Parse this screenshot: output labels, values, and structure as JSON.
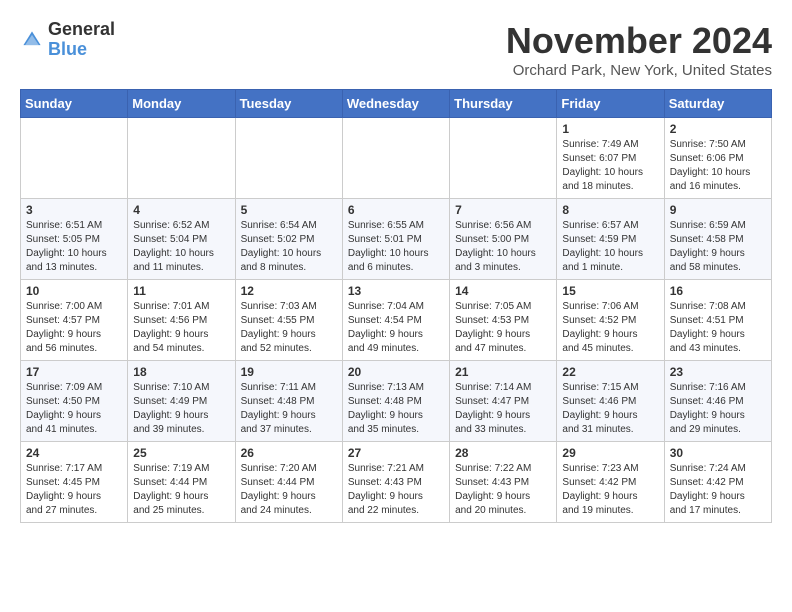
{
  "header": {
    "logo_general": "General",
    "logo_blue": "Blue",
    "month_title": "November 2024",
    "location": "Orchard Park, New York, United States"
  },
  "days_of_week": [
    "Sunday",
    "Monday",
    "Tuesday",
    "Wednesday",
    "Thursday",
    "Friday",
    "Saturday"
  ],
  "weeks": [
    [
      {
        "day": "",
        "info": ""
      },
      {
        "day": "",
        "info": ""
      },
      {
        "day": "",
        "info": ""
      },
      {
        "day": "",
        "info": ""
      },
      {
        "day": "",
        "info": ""
      },
      {
        "day": "1",
        "info": "Sunrise: 7:49 AM\nSunset: 6:07 PM\nDaylight: 10 hours\nand 18 minutes."
      },
      {
        "day": "2",
        "info": "Sunrise: 7:50 AM\nSunset: 6:06 PM\nDaylight: 10 hours\nand 16 minutes."
      }
    ],
    [
      {
        "day": "3",
        "info": "Sunrise: 6:51 AM\nSunset: 5:05 PM\nDaylight: 10 hours\nand 13 minutes."
      },
      {
        "day": "4",
        "info": "Sunrise: 6:52 AM\nSunset: 5:04 PM\nDaylight: 10 hours\nand 11 minutes."
      },
      {
        "day": "5",
        "info": "Sunrise: 6:54 AM\nSunset: 5:02 PM\nDaylight: 10 hours\nand 8 minutes."
      },
      {
        "day": "6",
        "info": "Sunrise: 6:55 AM\nSunset: 5:01 PM\nDaylight: 10 hours\nand 6 minutes."
      },
      {
        "day": "7",
        "info": "Sunrise: 6:56 AM\nSunset: 5:00 PM\nDaylight: 10 hours\nand 3 minutes."
      },
      {
        "day": "8",
        "info": "Sunrise: 6:57 AM\nSunset: 4:59 PM\nDaylight: 10 hours\nand 1 minute."
      },
      {
        "day": "9",
        "info": "Sunrise: 6:59 AM\nSunset: 4:58 PM\nDaylight: 9 hours\nand 58 minutes."
      }
    ],
    [
      {
        "day": "10",
        "info": "Sunrise: 7:00 AM\nSunset: 4:57 PM\nDaylight: 9 hours\nand 56 minutes."
      },
      {
        "day": "11",
        "info": "Sunrise: 7:01 AM\nSunset: 4:56 PM\nDaylight: 9 hours\nand 54 minutes."
      },
      {
        "day": "12",
        "info": "Sunrise: 7:03 AM\nSunset: 4:55 PM\nDaylight: 9 hours\nand 52 minutes."
      },
      {
        "day": "13",
        "info": "Sunrise: 7:04 AM\nSunset: 4:54 PM\nDaylight: 9 hours\nand 49 minutes."
      },
      {
        "day": "14",
        "info": "Sunrise: 7:05 AM\nSunset: 4:53 PM\nDaylight: 9 hours\nand 47 minutes."
      },
      {
        "day": "15",
        "info": "Sunrise: 7:06 AM\nSunset: 4:52 PM\nDaylight: 9 hours\nand 45 minutes."
      },
      {
        "day": "16",
        "info": "Sunrise: 7:08 AM\nSunset: 4:51 PM\nDaylight: 9 hours\nand 43 minutes."
      }
    ],
    [
      {
        "day": "17",
        "info": "Sunrise: 7:09 AM\nSunset: 4:50 PM\nDaylight: 9 hours\nand 41 minutes."
      },
      {
        "day": "18",
        "info": "Sunrise: 7:10 AM\nSunset: 4:49 PM\nDaylight: 9 hours\nand 39 minutes."
      },
      {
        "day": "19",
        "info": "Sunrise: 7:11 AM\nSunset: 4:48 PM\nDaylight: 9 hours\nand 37 minutes."
      },
      {
        "day": "20",
        "info": "Sunrise: 7:13 AM\nSunset: 4:48 PM\nDaylight: 9 hours\nand 35 minutes."
      },
      {
        "day": "21",
        "info": "Sunrise: 7:14 AM\nSunset: 4:47 PM\nDaylight: 9 hours\nand 33 minutes."
      },
      {
        "day": "22",
        "info": "Sunrise: 7:15 AM\nSunset: 4:46 PM\nDaylight: 9 hours\nand 31 minutes."
      },
      {
        "day": "23",
        "info": "Sunrise: 7:16 AM\nSunset: 4:46 PM\nDaylight: 9 hours\nand 29 minutes."
      }
    ],
    [
      {
        "day": "24",
        "info": "Sunrise: 7:17 AM\nSunset: 4:45 PM\nDaylight: 9 hours\nand 27 minutes."
      },
      {
        "day": "25",
        "info": "Sunrise: 7:19 AM\nSunset: 4:44 PM\nDaylight: 9 hours\nand 25 minutes."
      },
      {
        "day": "26",
        "info": "Sunrise: 7:20 AM\nSunset: 4:44 PM\nDaylight: 9 hours\nand 24 minutes."
      },
      {
        "day": "27",
        "info": "Sunrise: 7:21 AM\nSunset: 4:43 PM\nDaylight: 9 hours\nand 22 minutes."
      },
      {
        "day": "28",
        "info": "Sunrise: 7:22 AM\nSunset: 4:43 PM\nDaylight: 9 hours\nand 20 minutes."
      },
      {
        "day": "29",
        "info": "Sunrise: 7:23 AM\nSunset: 4:42 PM\nDaylight: 9 hours\nand 19 minutes."
      },
      {
        "day": "30",
        "info": "Sunrise: 7:24 AM\nSunset: 4:42 PM\nDaylight: 9 hours\nand 17 minutes."
      }
    ]
  ]
}
